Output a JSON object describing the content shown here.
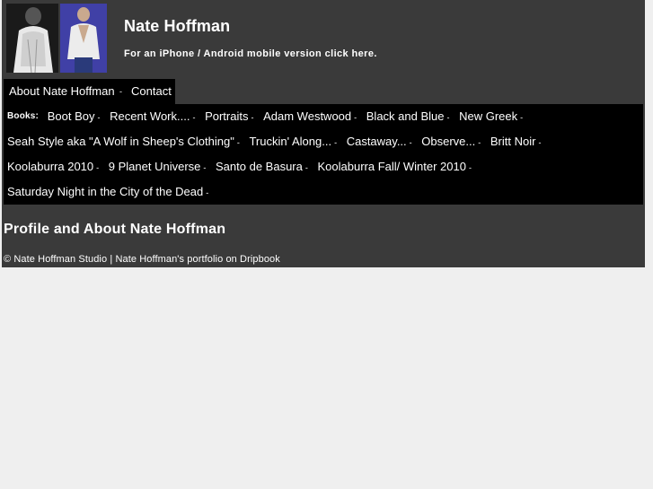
{
  "header": {
    "title": "Nate Hoffman",
    "mobile_link": "For an iPhone / Android mobile version click here."
  },
  "nav": {
    "items": [
      "About Nate Hoffman",
      "Contact"
    ],
    "separator": "-"
  },
  "books": {
    "label": "Books:",
    "separator": "-",
    "rows": [
      [
        "Boot Boy",
        "Recent Work....",
        "Portraits",
        "Adam Westwood",
        "Black and Blue",
        "New Greek"
      ],
      [
        "Seah Style aka \"A Wolf in Sheep's Clothing\"",
        "Truckin' Along...",
        "Castaway...",
        "Observe...",
        "Britt Noir"
      ],
      [
        "Koolaburra 2010",
        "9 Planet Universe",
        "Santo de Basura",
        "Koolaburra Fall/ Winter 2010"
      ],
      [
        "Saturday Night in the City of the Dead"
      ]
    ]
  },
  "main": {
    "heading": "Profile and About Nate Hoffman"
  },
  "footer": {
    "text": "© Nate Hoffman Studio | Nate Hoffman's portfolio on Dripbook"
  },
  "colors": {
    "page_bg": "#3a3a3a",
    "nav_bg": "#000000",
    "outer_bg": "#efefef",
    "text": "#ffffff"
  }
}
